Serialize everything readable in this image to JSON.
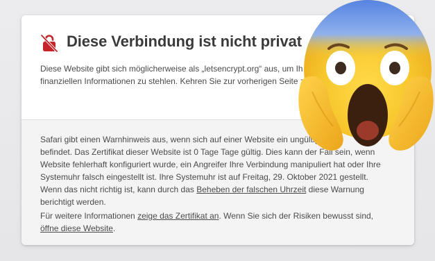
{
  "warning_page": {
    "title": "Diese Verbindung ist nicht privat",
    "intro_line1": "Diese Website gibt sich möglicherweise als „letsencrypt.org“ aus, um Ih",
    "intro_line2": "finanziellen Informationen zu stehlen. Kehren Sie zur vorherigen Seite z",
    "details_line1": "Safari gibt einen Warnhinweis aus, wenn sich auf einer Website ein ungültiges Zer",
    "details_line2": "befindet. Das Zertifikat dieser Website ist 0 Tage Tage gültig. Dies kann der Fall sein, wenn",
    "details_line3": "Website fehlerhaft konfiguriert wurde, ein Angreifer Ihre Verbindung manipuliert hat oder Ihre",
    "details_line4": "Systemuhr falsch eingestellt ist. Ihre Systemuhr ist auf Freitag, 29. Oktober 2021 gestellt.",
    "details_line5_pre": "Wenn das nicht richtig ist, kann durch das ",
    "details_line5_link": "Beheben der falschen Uhrzeit",
    "details_line5_post": " diese Warnung",
    "details_line6": "berichtigt werden.",
    "more_line1_pre": "Für weitere Informationen ",
    "more_line1_link": "zeige das Zertifikat an",
    "more_line1_post": ". Wenn Sie sich der Risiken bewusst sind,",
    "more_line2_link": "öffne diese Website",
    "more_line2_post": "."
  },
  "icons": {
    "warning": "broken-lock-icon",
    "overlay": "face-screaming-in-fear-emoji"
  },
  "colors": {
    "warning_red": "#c6242b",
    "title_text": "#3a3a3c",
    "body_text": "#4a4a4c",
    "details_background": "#f4f4f5",
    "emoji_yellow": "#f7c82d"
  }
}
